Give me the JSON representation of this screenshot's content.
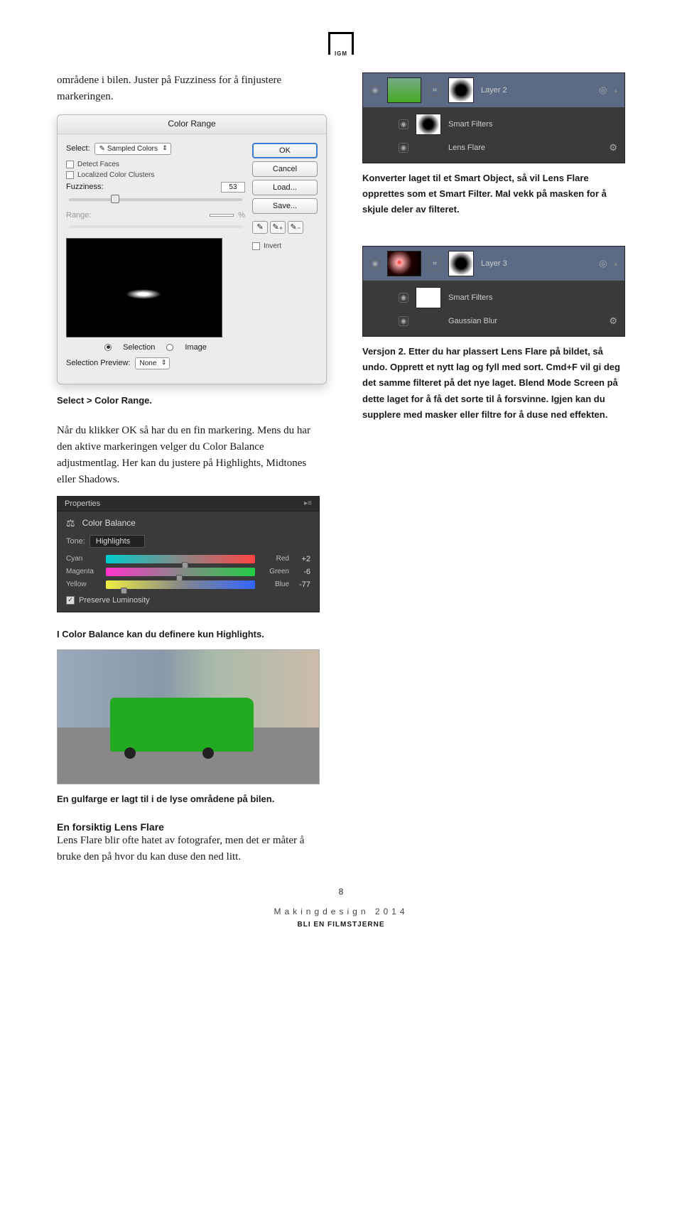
{
  "logo_text": "IGM",
  "body": {
    "intro": "områdene i bilen. Juster på Fuzziness for å finjustere markeringen.",
    "caption_select": "Select > Color Range.",
    "para_ok": "Når du klikker OK så har du en fin markering. Mens du har den aktive markeringen velger du Color Balance adjustmentlag. Her kan du justere på Highlights, Midtones eller Shadows.",
    "caption_cb": "I Color Balance kan du definere kun Highlights.",
    "caption_van": "En gulfarge er lagt til i de lyse områdene på bilen.",
    "h_lens": "En forsiktig Lens Flare",
    "para_lens": "Lens Flare blir ofte hatet av fotografer, men det er måter å bruke den på hvor du kan duse den ned litt.",
    "right_konv": "Konverter laget til et Smart Object, så vil Lens Flare opprettes som et Smart Filter. Mal vekk på masken for å skjule deler av filteret.",
    "right_v2": "Versjon 2. Etter du har plassert Lens Flare på bildet, så undo. Opprett et nytt lag og fyll med sort. Cmd+F vil gi deg det samme filteret på det nye laget. Blend Mode Screen på dette laget for å få det sorte til å forsvinne. Igjen kan du supplere med masker eller filtre for å duse ned effekten."
  },
  "dialog": {
    "title": "Color Range",
    "select_label": "Select:",
    "select_value": "Sampled Colors",
    "detect_faces": "Detect Faces",
    "localized": "Localized Color Clusters",
    "fuzziness": "Fuzziness:",
    "fuzziness_val": "53",
    "range": "Range:",
    "range_unit": "%",
    "selection": "Selection",
    "image": "Image",
    "sel_preview": "Selection Preview:",
    "sel_preview_val": "None",
    "btn_ok": "OK",
    "btn_cancel": "Cancel",
    "btn_load": "Load...",
    "btn_save": "Save...",
    "invert": "Invert"
  },
  "layers1": {
    "layer2": "Layer 2",
    "smart": "Smart Filters",
    "lens": "Lens Flare"
  },
  "layers2": {
    "layer3": "Layer 3",
    "smart": "Smart Filters",
    "blur": "Gaussian Blur"
  },
  "props": {
    "tab": "Properties",
    "title": "Color Balance",
    "tone_label": "Tone:",
    "tone_val": "Highlights",
    "cyan": "Cyan",
    "red": "Red",
    "val1": "+2",
    "magenta": "Magenta",
    "green": "Green",
    "val2": "-6",
    "yellow": "Yellow",
    "blue": "Blue",
    "val3": "-77",
    "preserve": "Preserve Luminosity"
  },
  "footer": {
    "page": "8",
    "line1": "Makingdesign 2014",
    "line2": "BLI EN FILMSTJERNE"
  }
}
